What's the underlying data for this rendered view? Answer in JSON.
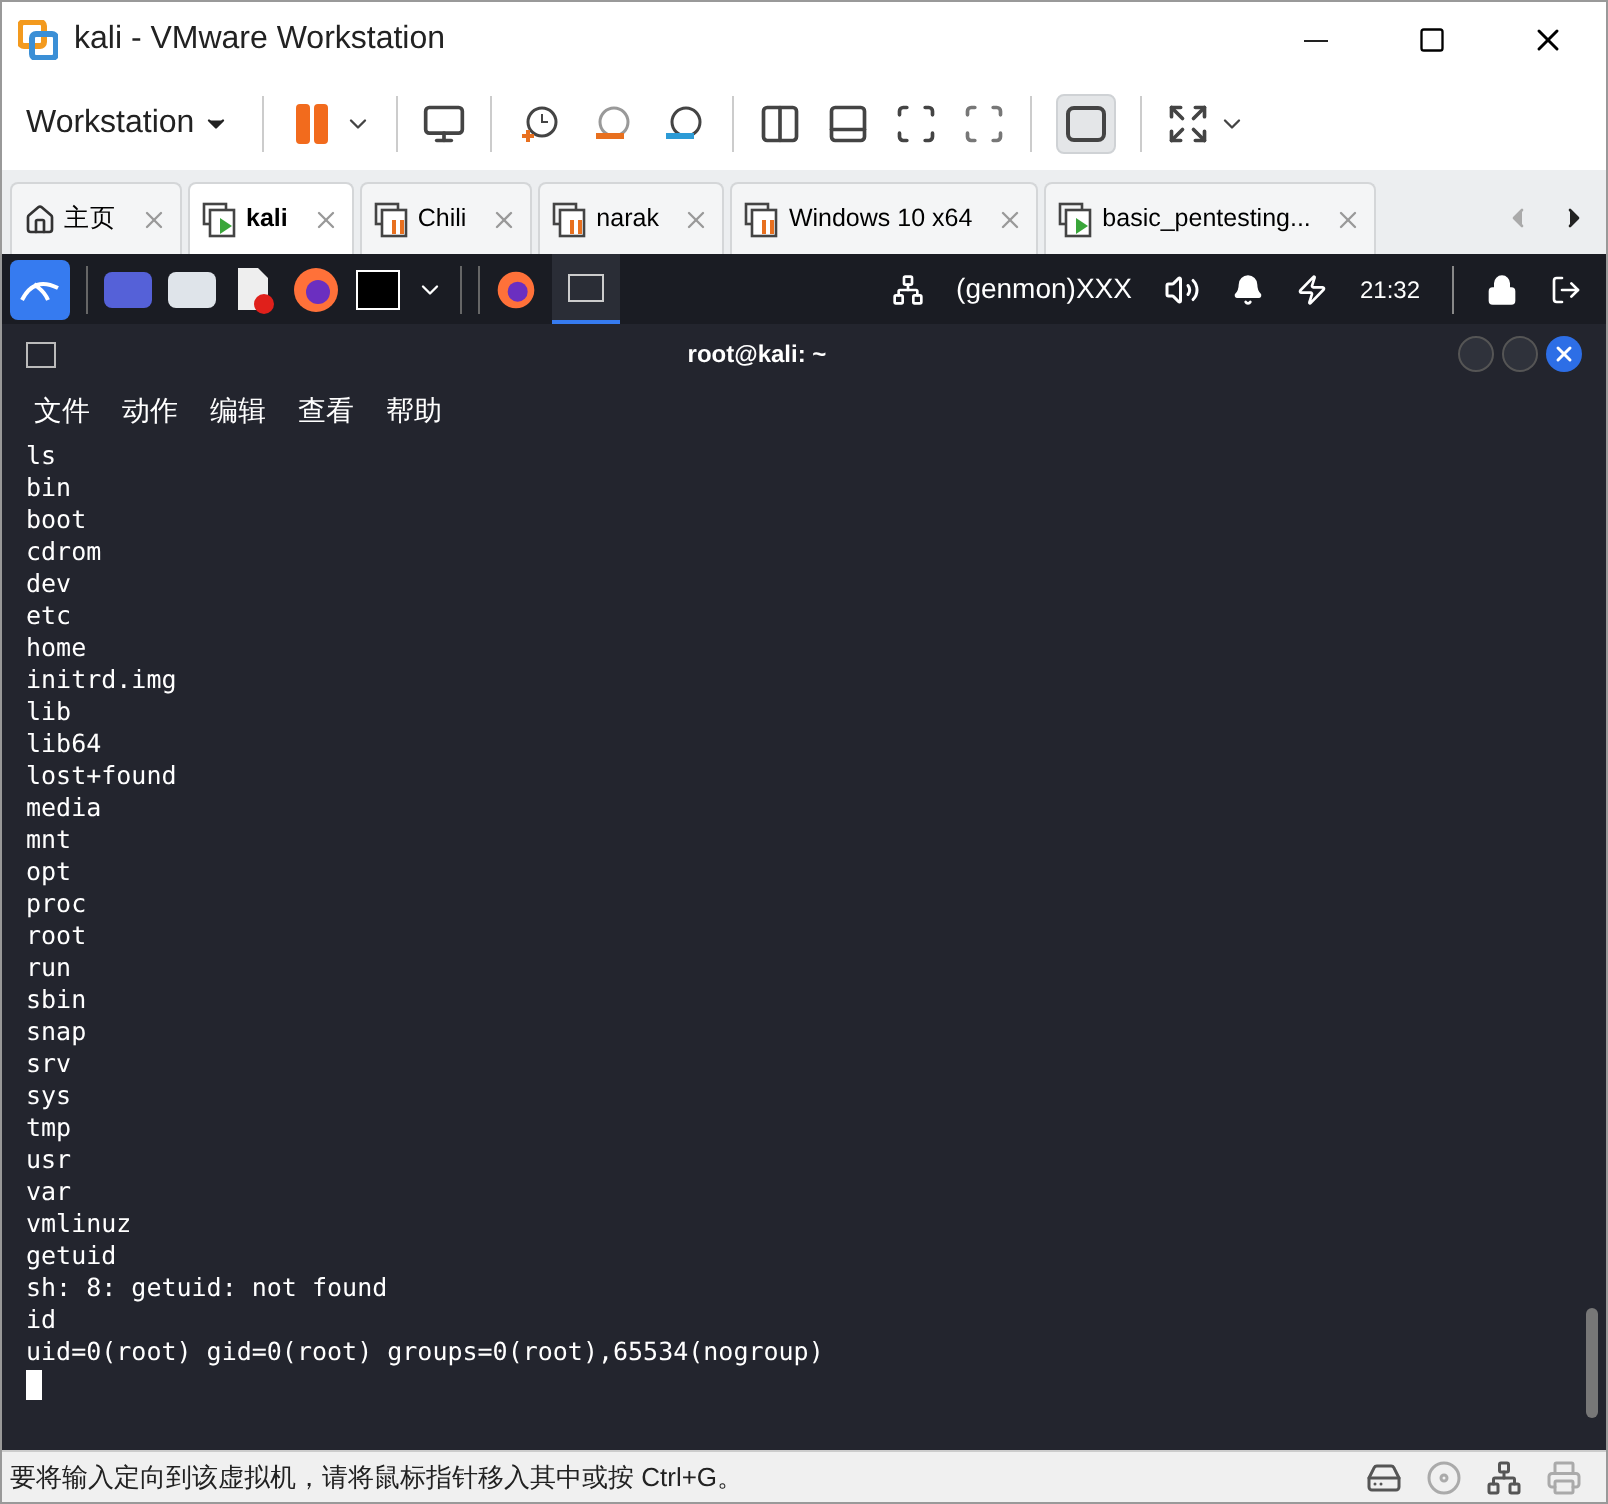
{
  "window": {
    "title": "kali - VMware Workstation"
  },
  "toolbar": {
    "menu_label": "Workstation"
  },
  "tabs": [
    {
      "label": "主页",
      "kind": "home",
      "selected": false
    },
    {
      "label": "kali",
      "kind": "running",
      "selected": true
    },
    {
      "label": "Chili",
      "kind": "paused",
      "selected": false
    },
    {
      "label": "narak",
      "kind": "paused",
      "selected": false
    },
    {
      "label": "Windows 10 x64",
      "kind": "paused",
      "selected": false
    },
    {
      "label": "basic_pentesting...",
      "kind": "running",
      "selected": false
    }
  ],
  "panel": {
    "genmon": "(genmon)XXX",
    "clock": "21:32"
  },
  "terminal": {
    "title": "root@kali: ~",
    "menu": [
      "文件",
      "动作",
      "编辑",
      "查看",
      "帮助"
    ],
    "lines": [
      "ls",
      "bin",
      "boot",
      "cdrom",
      "dev",
      "etc",
      "home",
      "initrd.img",
      "lib",
      "lib64",
      "lost+found",
      "media",
      "mnt",
      "opt",
      "proc",
      "root",
      "run",
      "sbin",
      "snap",
      "srv",
      "sys",
      "tmp",
      "usr",
      "var",
      "vmlinuz",
      "getuid",
      "sh: 8: getuid: not found",
      "id",
      "uid=0(root) gid=0(root) groups=0(root),65534(nogroup)"
    ]
  },
  "status_bar": {
    "text": "要将输入定向到该虚拟机，请将鼠标指针移入其中或按 Ctrl+G。"
  }
}
